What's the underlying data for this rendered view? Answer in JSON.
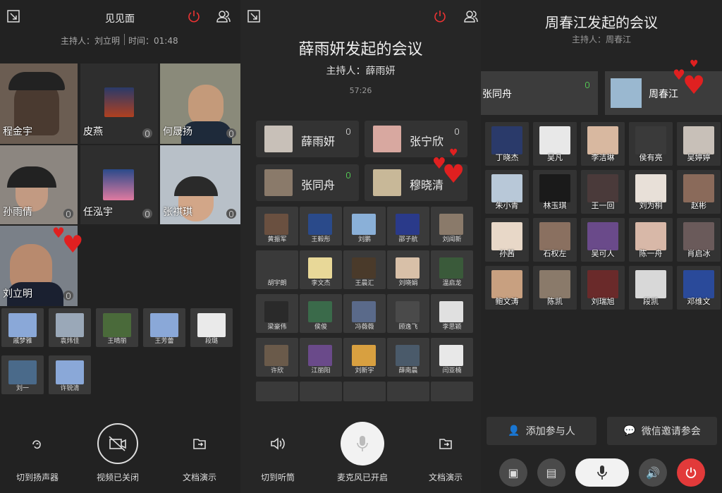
{
  "p1": {
    "title": "见见面",
    "host_label": "主持人：刘立明",
    "time_label": "时间：01:48",
    "videos": [
      "程金宇",
      "皮燕",
      "何晟扬",
      "孙雨倩",
      "任泓宇",
      "张祺琪",
      "刘立明"
    ],
    "thumbs": [
      "戚梦雅",
      "袁炜佳",
      "王晴丽",
      "王芳蕾",
      "段璐",
      "刘一",
      "许锐清"
    ],
    "btn_speaker": "切到扬声器",
    "btn_video": "视频已关闭",
    "btn_doc": "文档演示"
  },
  "p2": {
    "title": "薛雨妍发起的会议",
    "host": "主持人：薛雨妍",
    "time": "57:26",
    "main": [
      "薛雨妍",
      "张宁欣",
      "张同舟",
      "穆晓清"
    ],
    "grid": [
      "黄振军",
      "王毅彤",
      "刘鹏",
      "邵子航",
      "刘闻新",
      "胡宇朗",
      "李文杰",
      "王晨汇",
      "刘晓娟",
      "温启龙",
      "梁豪伟",
      "侯俊",
      "冯薇薇",
      "顾逸飞",
      "李思颖",
      "许欣",
      "江丽阳",
      "刘新宇",
      "薛南晨",
      "闫亚楠"
    ],
    "btn_handset": "切到听筒",
    "btn_mic": "麦克风已开启",
    "btn_doc": "文档演示"
  },
  "p3": {
    "title": "周春江发起的会议",
    "host": "主持人：周春江",
    "main": [
      "张同舟",
      "周春江"
    ],
    "grid": [
      "丁晓杰",
      "吴凡",
      "李洁琳",
      "侯有亮",
      "吴婷婷",
      "朱小青",
      "林玉琪",
      "王一回",
      "刘为桐",
      "赵彬",
      "孙茜",
      "石权左",
      "吴可人",
      "陈一舟",
      "肖启冰",
      "鲍文涛",
      "陈凯",
      "刘瑞旭",
      "段凯",
      "邓维文"
    ],
    "btn_add": "添加参与人",
    "btn_wechat": "微信邀请参会"
  }
}
